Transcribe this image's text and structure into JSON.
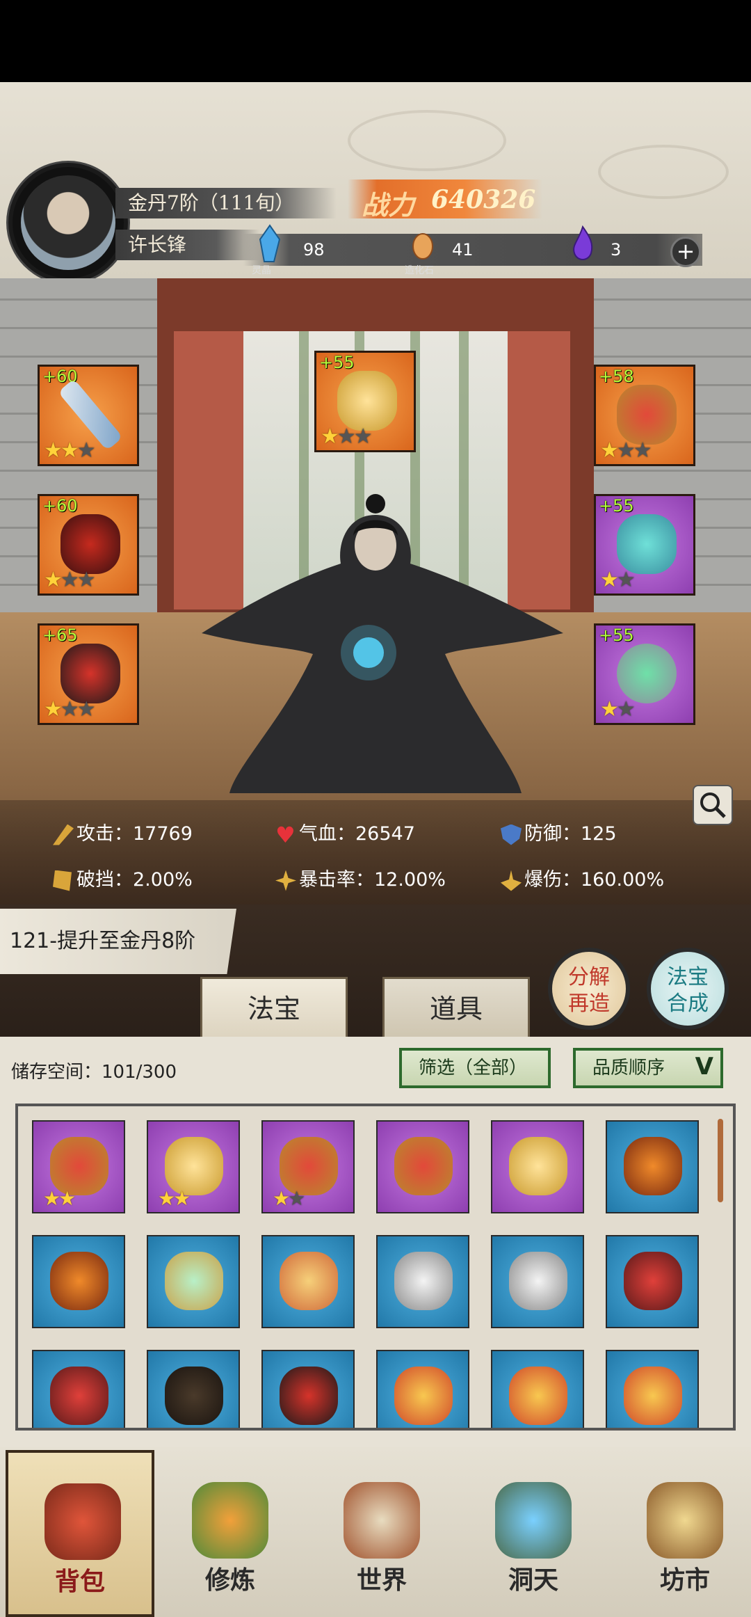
{
  "header": {
    "realm": "金丹7阶（111旬）",
    "player_name": "许长锋",
    "power_label": "战力",
    "power_value": "640326",
    "resources": [
      {
        "name": "灵晶",
        "value": "98",
        "color": "#4aa8e8"
      },
      {
        "name": "造化石",
        "value": "41",
        "color": "#e8a45a"
      },
      {
        "name": "",
        "value": "3",
        "color": "#7a3bd8"
      }
    ],
    "add_button": "+"
  },
  "equipment": {
    "left": [
      {
        "plus": "+60",
        "rarity": "orange",
        "stars": 2,
        "item": "sword"
      },
      {
        "plus": "+60",
        "rarity": "orange",
        "stars": 1,
        "item": "robe"
      },
      {
        "plus": "+65",
        "rarity": "orange",
        "stars": 1,
        "item": "boots"
      }
    ],
    "top": {
      "plus": "+55",
      "rarity": "orange",
      "stars": 1,
      "item": "golden-cloud"
    },
    "right": [
      {
        "plus": "+58",
        "rarity": "orange",
        "stars": 1,
        "item": "crown"
      },
      {
        "plus": "+55",
        "rarity": "purple",
        "stars": 1,
        "item": "necklace"
      },
      {
        "plus": "+55",
        "rarity": "purple",
        "stars": 1,
        "item": "ring"
      }
    ]
  },
  "stats": {
    "attack": "攻击：17769",
    "hp": "气血：26547",
    "defense": "防御：125",
    "block_break": "破挡：2.00%",
    "crit_rate": "暴击率：12.00%",
    "crit_damage": "爆伤：160.00%"
  },
  "quest": "121-提升至金丹8阶",
  "actions": {
    "decompose": [
      "分解",
      "再造"
    ],
    "synthesize": [
      "法宝",
      "合成"
    ]
  },
  "tabs": [
    "法宝",
    "道具"
  ],
  "inventory": {
    "storage": "储存空间：101/300",
    "filter": "筛选（全部）",
    "sort": "品质顺序",
    "items": [
      {
        "rarity": "purple",
        "stars": 2,
        "item": "crown"
      },
      {
        "rarity": "purple",
        "stars": 2,
        "item": "golden-cloud"
      },
      {
        "rarity": "purple",
        "stars": 1,
        "item": "crown"
      },
      {
        "rarity": "purple",
        "stars": 0,
        "item": "crown"
      },
      {
        "rarity": "purple",
        "stars": 0,
        "item": "golden-cloud"
      },
      {
        "rarity": "blue",
        "stars": 0,
        "item": "axe"
      },
      {
        "rarity": "blue",
        "stars": 0,
        "item": "axe"
      },
      {
        "rarity": "blue",
        "stars": 0,
        "item": "mirror"
      },
      {
        "rarity": "blue",
        "stars": 0,
        "item": "ornament"
      },
      {
        "rarity": "blue",
        "stars": 0,
        "item": "white-robe"
      },
      {
        "rarity": "blue",
        "stars": 0,
        "item": "white-robe"
      },
      {
        "rarity": "blue",
        "stars": 0,
        "item": "red-armor"
      },
      {
        "rarity": "blue",
        "stars": 0,
        "item": "red-armor"
      },
      {
        "rarity": "blue",
        "stars": 0,
        "item": "dark-robe"
      },
      {
        "rarity": "blue",
        "stars": 0,
        "item": "boots"
      },
      {
        "rarity": "blue",
        "stars": 0,
        "item": "feather"
      },
      {
        "rarity": "blue",
        "stars": 0,
        "item": "feather"
      },
      {
        "rarity": "blue",
        "stars": 0,
        "item": "feather"
      }
    ]
  },
  "nav": [
    {
      "label": "背包",
      "icon": "bag-icon",
      "active": true
    },
    {
      "label": "修炼",
      "icon": "lotus-icon",
      "active": false
    },
    {
      "label": "世界",
      "icon": "scroll-map-icon",
      "active": false
    },
    {
      "label": "洞天",
      "icon": "portal-icon",
      "active": false
    },
    {
      "label": "坊市",
      "icon": "market-stall-icon",
      "active": false
    }
  ]
}
